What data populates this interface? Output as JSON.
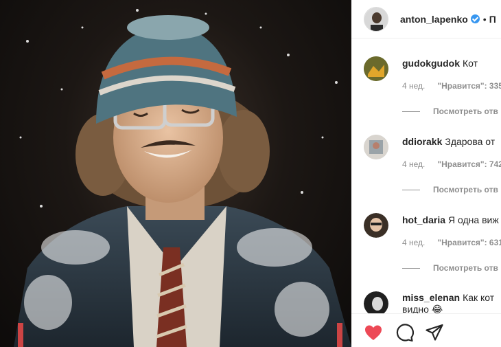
{
  "post": {
    "photo_icon": "photo-person-in-snow",
    "author": "anton_lapenko",
    "separator": "•",
    "follow": "П"
  },
  "comments": [
    {
      "user": "gudokgudok",
      "text": "Кот",
      "time": "4 нед.",
      "likes": "\"Нравится\": 335",
      "replies": "Посмотреть отв"
    },
    {
      "user": "ddiorakk",
      "text": "Здарова от",
      "time": "4 нед.",
      "likes": "\"Нравится\": 742",
      "replies": "Посмотреть отв"
    },
    {
      "user": "hot_daria",
      "text": "Я одна виж",
      "time": "4 нед.",
      "likes": "\"Нравится\": 631",
      "replies": "Посмотреть отв"
    },
    {
      "user": "miss_elenan",
      "text": "Как кот",
      "text2": "видно 😂"
    }
  ],
  "actions": {
    "like_icon": "heart-filled-icon",
    "comment_icon": "comment-bubble-icon",
    "share_icon": "paper-plane-icon"
  },
  "colors": {
    "like": "#ed4956",
    "verified": "#3897f0",
    "muted": "#8e8e8e",
    "text": "#262626"
  }
}
